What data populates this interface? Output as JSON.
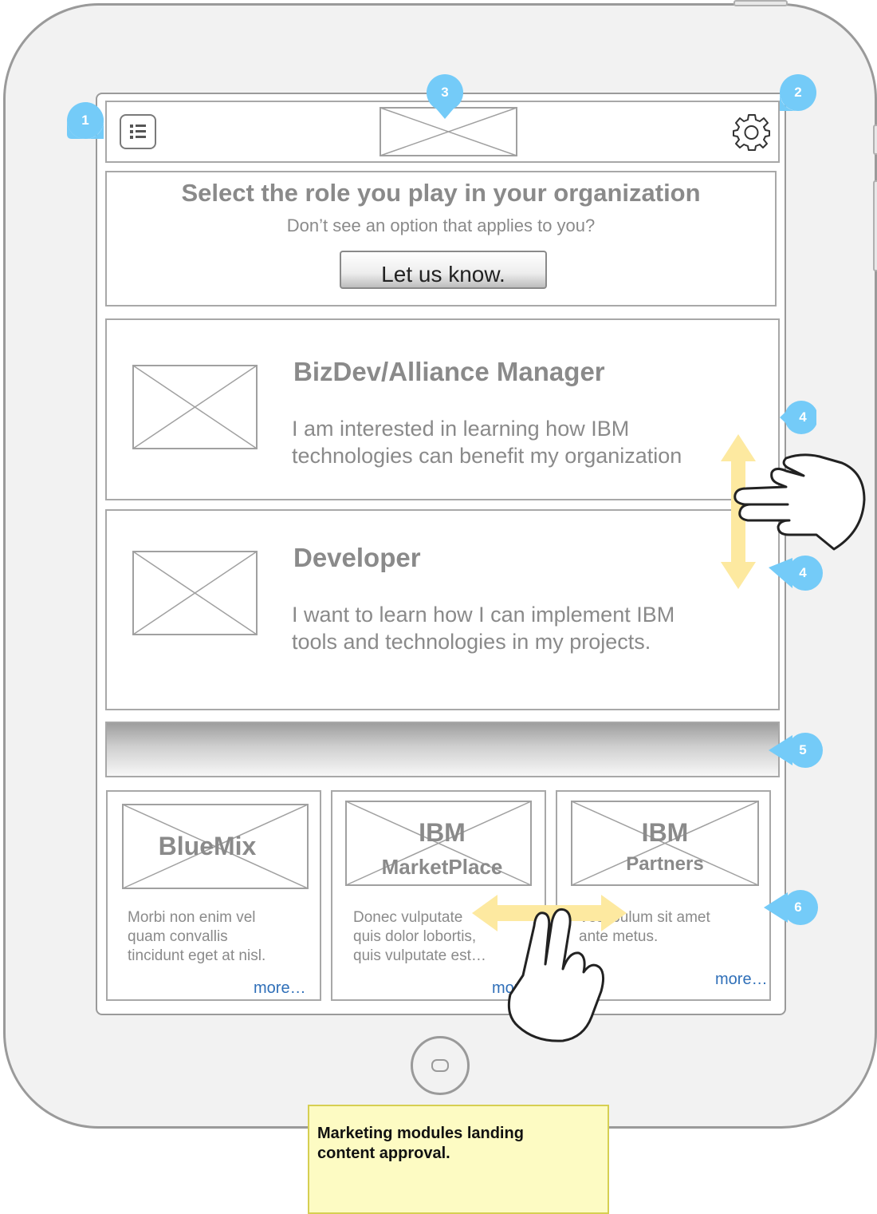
{
  "header": {
    "menu_icon": "list-icon",
    "settings_icon": "gear-icon",
    "logo": "logo-placeholder"
  },
  "intro": {
    "title": "Select the role you play in your organization",
    "subtitle": "Don’t see an option that applies to you?",
    "button_label": "Let us know."
  },
  "roles": [
    {
      "title": "BizDev/Alliance Manager",
      "description_line1": "I am interested in learning how IBM",
      "description_line2": "technologies can benefit my organization"
    },
    {
      "title": "Developer",
      "description_line1": "I want to learn how I can implement IBM",
      "description_line2": "tools and technologies in my projects."
    }
  ],
  "modules": [
    {
      "title_line1": "BlueMix",
      "title_line2": "",
      "text_line1": "Morbi non enim vel",
      "text_line2": "quam convallis",
      "text_line3": "tincidunt eget at nisl.",
      "more": "more…"
    },
    {
      "title_line1": "IBM",
      "title_line2": "MarketPlace",
      "text_line1": "Donec vulputate",
      "text_line2": "quis dolor lobortis,",
      "text_line3": "quis vulputate est…",
      "more": "more…"
    },
    {
      "title_line1": "IBM",
      "title_line2": "Partners",
      "text_line1": "Vestibulum sit amet",
      "text_line2": "ante metus.",
      "text_line3": "",
      "more": "more…"
    }
  ],
  "callouts": [
    "1",
    "2",
    "3",
    "4",
    "4",
    "5",
    "6"
  ],
  "note": "Marketing modules landing content approval.",
  "colors": {
    "callout": "#74cbf8",
    "gesture_arrow": "#fde9a0",
    "note_bg": "#fdfbc3",
    "link": "#2f6fb8"
  }
}
